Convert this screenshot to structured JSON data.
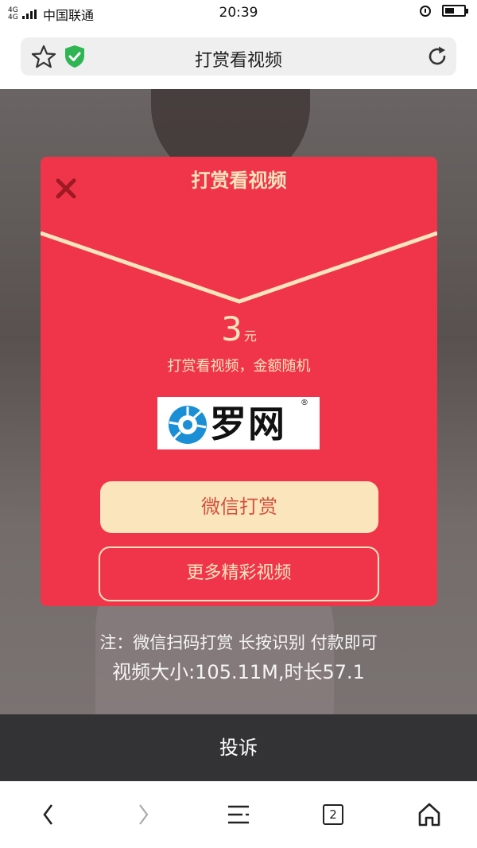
{
  "status_bar": {
    "network": "4G 4G",
    "carrier": "中国联通",
    "time": "20:39",
    "battery_level": 0.5
  },
  "browser": {
    "title": "打赏看视频",
    "icons": {
      "bookmark": "star-icon",
      "security": "shield-check-icon",
      "reload": "reload-icon"
    }
  },
  "modal": {
    "title": "打赏看视频",
    "amount_value": "3",
    "amount_unit": "元",
    "subtitle": "打赏看视频，金额随机",
    "logo_text": "罗网",
    "logo_reg": "®",
    "primary_button": "微信打赏",
    "secondary_button": "更多精彩视频"
  },
  "note": "注：微信扫码打赏 长按识别 付款即可",
  "video_info": "视频大小:105.11M,时长57.1",
  "complain_button": "投诉",
  "bottom_nav": {
    "tab_count": "2"
  },
  "colors": {
    "modal_red": "#f0354b",
    "cream": "#fbe5bd",
    "primary_text": "#d2533d",
    "complain_bg": "#333235"
  }
}
